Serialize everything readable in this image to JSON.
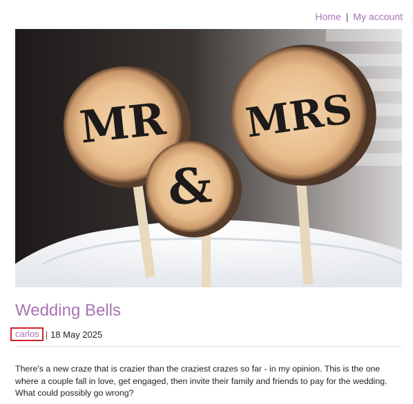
{
  "nav": {
    "home": "Home",
    "separator": "|",
    "account": "My account"
  },
  "hero": {
    "alt_icon": "wedding-cake-topper-photo",
    "left_disc_text": "MR",
    "middle_disc_text": "&",
    "right_disc_text": "MRS"
  },
  "post": {
    "title": "Wedding Bells",
    "author": "carlos",
    "meta_separator": "|",
    "date": "18 May 2025",
    "body": "There's a new craze that is crazier than the craziest crazes so far - in my opinion. This is the one where a couple fall in love, get engaged, then invite their family and friends to pay for the wedding. What could possibly go wrong?"
  },
  "colors": {
    "accent": "#a873b4",
    "highlight_border": "#d0242b",
    "text": "#222222"
  }
}
